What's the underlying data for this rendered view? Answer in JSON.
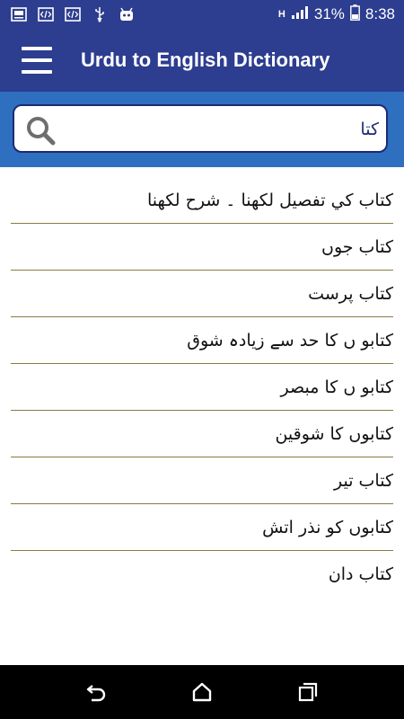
{
  "status_bar": {
    "battery_percent": "31%",
    "time": "8:38",
    "network": "H",
    "icons": [
      "image-icon",
      "code-icon",
      "code-icon",
      "usb-icon",
      "android-icon"
    ]
  },
  "app_bar": {
    "title": "Urdu to English Dictionary"
  },
  "search": {
    "value": "کتا"
  },
  "results": [
    "کتاب کي تفصيل لکھنا ۔ شرح لکھنا",
    "کتاب جوں",
    "کتاب پرست",
    "کتابو ں کا حد سے زیادہ شوق",
    "کتابو ں کا مبصر",
    "کتابوں کا شوقین",
    "کتاب تیر",
    "کتابوں کو نذر اتش",
    "کتاب دان"
  ],
  "colors": {
    "app_bar": "#2d3d8f",
    "search_area": "#2f6fbf",
    "search_border": "#1c2b73",
    "divider": "#8a7a45"
  }
}
